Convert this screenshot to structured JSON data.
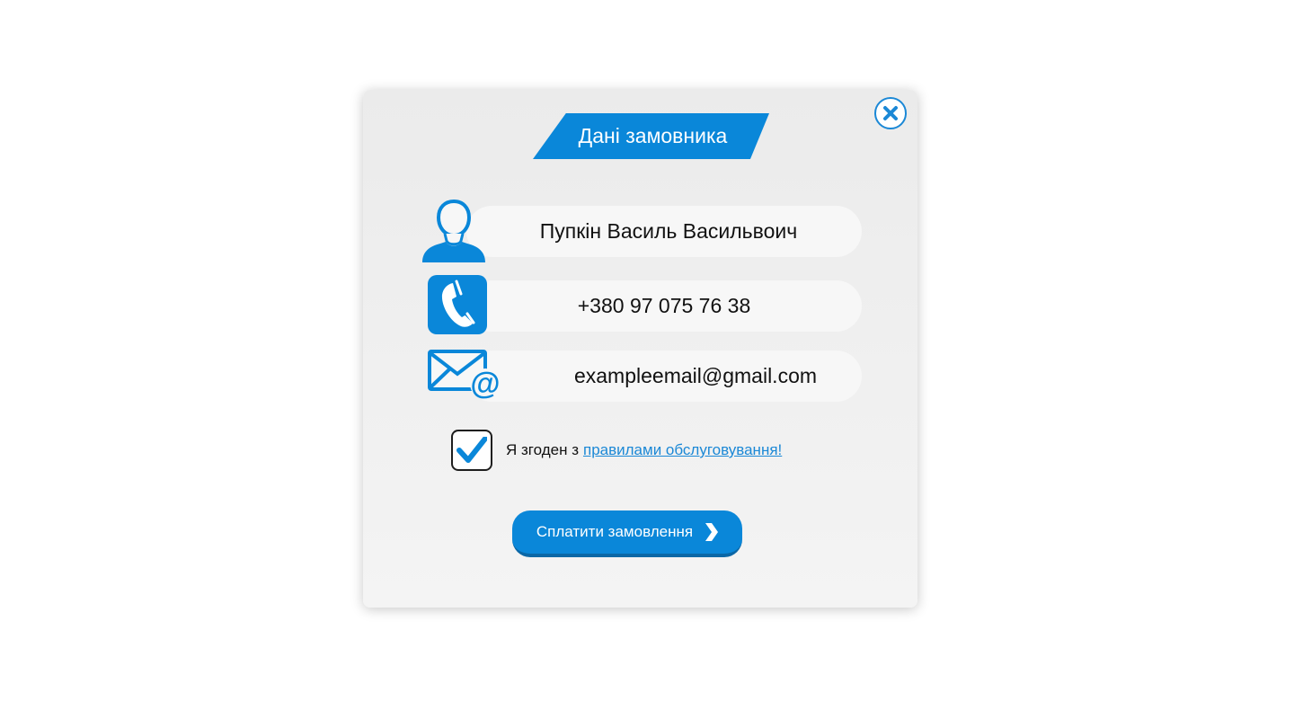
{
  "modal": {
    "title": "Дані замовника",
    "close_icon": "close-x-circle-icon",
    "fields": {
      "name": {
        "value": "Пупкін Василь Васильвоич",
        "icon": "user-icon"
      },
      "phone": {
        "value": "+380 97 075 76 38",
        "icon": "phone-icon"
      },
      "email": {
        "value": "exampleemail@gmail.com",
        "icon": "email-at-icon"
      }
    },
    "agreement": {
      "checked": true,
      "text": "Я згоден з",
      "link_text": "правилами обслуговування!"
    },
    "pay_button": {
      "label": "Сплатити замовлення",
      "icon": "chevron-right-icon"
    }
  },
  "colors": {
    "accent": "#0a87d9",
    "accent_dark": "#0b67a6",
    "link": "#1b88d6",
    "field_bg": "#f7f7f7",
    "modal_bg": "#efefef"
  }
}
